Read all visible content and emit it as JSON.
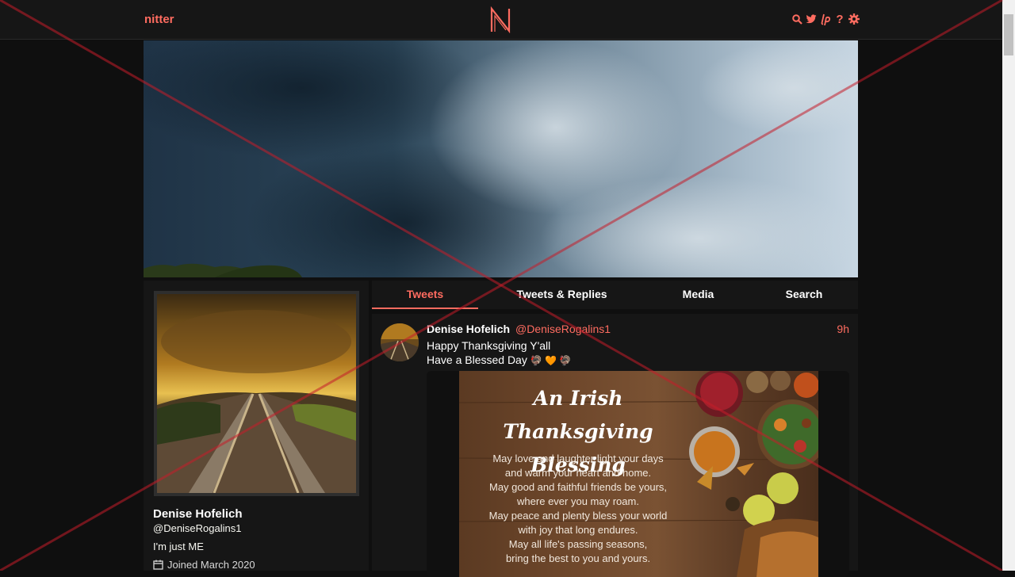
{
  "navbar": {
    "brand": "nitter",
    "logo_letter": "N",
    "icons": [
      "search-icon",
      "twitter-icon",
      "liberapay-icon",
      "help-icon",
      "gear-icon"
    ],
    "help_glyph": "?"
  },
  "profile": {
    "name": "Denise Hofelich",
    "handle": "@DeniseRogalins1",
    "bio": "I'm just ME",
    "joined": "Joined March 2020"
  },
  "tabs": [
    {
      "label": "Tweets",
      "active": true
    },
    {
      "label": "Tweets & Replies",
      "active": false
    },
    {
      "label": "Media",
      "active": false
    },
    {
      "label": "Search",
      "active": false
    }
  ],
  "tweet": {
    "name": "Denise Hofelich",
    "handle": "@DeniseRogalins1",
    "date": "9h",
    "line1": "Happy Thanksgiving Y'all",
    "line2": "Have a Blessed Day",
    "emojis": "🦃 🧡 🦃",
    "card": {
      "title_line1": "An Irish Thanksgiving",
      "title_line2": "Blessing",
      "body": [
        "May love and laughter light your days",
        "and warm your heart and home.",
        "May good and faithful friends be yours,",
        "where ever you may roam.",
        "May peace and plenty bless your world",
        "with joy that long endures.",
        "May all life's passing seasons,",
        "bring the best to you and yours."
      ]
    }
  },
  "colors": {
    "accent": "#ff6c60",
    "background": "#0f0f0f",
    "panel": "#161616"
  }
}
